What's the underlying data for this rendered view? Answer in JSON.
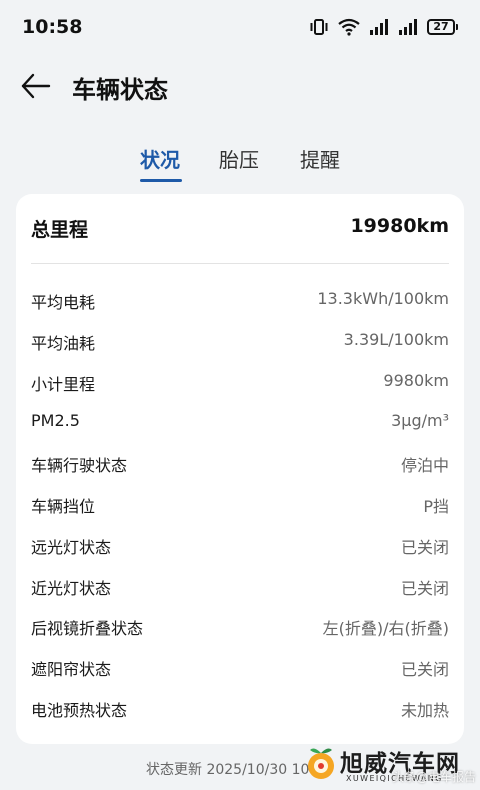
{
  "status_bar": {
    "time": "10:58",
    "battery_level": "27",
    "icons": [
      "vibrate-icon",
      "wifi-icon",
      "signal-icon",
      "signal-icon",
      "battery-icon"
    ]
  },
  "header": {
    "title": "车辆状态",
    "back_icon": "back-arrow-icon"
  },
  "tabs": [
    {
      "label": "状况",
      "active": true
    },
    {
      "label": "胎压",
      "active": false
    },
    {
      "label": "提醒",
      "active": false
    }
  ],
  "card": {
    "total_mileage": {
      "label": "总里程",
      "value": "19980km"
    },
    "rows": [
      {
        "label": "平均电耗",
        "value": "13.3kWh/100km"
      },
      {
        "label": "平均油耗",
        "value": "3.39L/100km"
      },
      {
        "label": "小计里程",
        "value": "9980km"
      },
      {
        "label": "PM2.5",
        "value": "3μg/m³"
      },
      {
        "label": "车辆行驶状态",
        "value": "停泊中"
      },
      {
        "label": "车辆挡位",
        "value": "P挡"
      },
      {
        "label": "远光灯状态",
        "value": "已关闭"
      },
      {
        "label": "近光灯状态",
        "value": "已关闭"
      },
      {
        "label": "后视镜折叠状态",
        "value": "左(折叠)/右(折叠)"
      },
      {
        "label": "遮阳帘状态",
        "value": "已关闭"
      },
      {
        "label": "电池预热状态",
        "value": "未加热"
      }
    ]
  },
  "footer": {
    "update_text": "状态更新 2025/10/30 10:58"
  },
  "watermark": {
    "main": "旭威汽车网",
    "sub": "XUWEIQICHEWANG",
    "overlay": "头条@电车报告"
  },
  "colors": {
    "accent": "#1e5aa8",
    "background": "#f1f3f5",
    "card": "#ffffff",
    "value_text": "#666666"
  }
}
